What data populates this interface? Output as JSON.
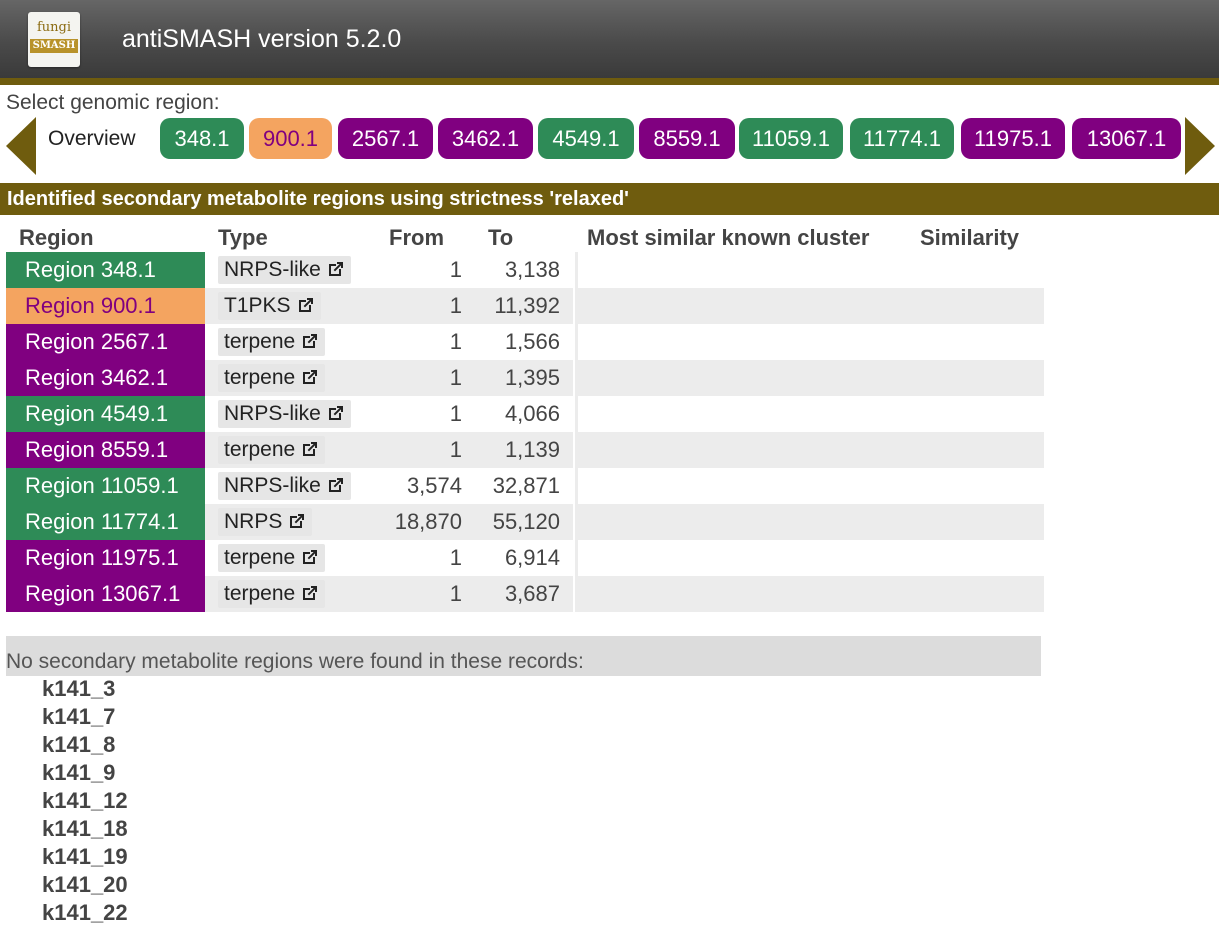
{
  "app": {
    "title": "antiSMASH version 5.2.0",
    "logo_top": "fungi",
    "logo_bottom": "SMASH"
  },
  "nav": {
    "label": "Select genomic region:",
    "overview": "Overview",
    "pills": [
      {
        "label": "348.1",
        "color": "#2e8b57"
      },
      {
        "label": "900.1",
        "color": "#f4a460"
      },
      {
        "label": "2567.1",
        "color": "#800080"
      },
      {
        "label": "3462.1",
        "color": "#800080"
      },
      {
        "label": "4549.1",
        "color": "#2e8b57"
      },
      {
        "label": "8559.1",
        "color": "#800080"
      },
      {
        "label": "11059.1",
        "color": "#2e8b57"
      },
      {
        "label": "11774.1",
        "color": "#2e8b57"
      },
      {
        "label": "11975.1",
        "color": "#800080"
      },
      {
        "label": "13067.1",
        "color": "#800080"
      }
    ]
  },
  "section_title": "Identified secondary metabolite regions using strictness 'relaxed'",
  "table": {
    "headers": {
      "region": "Region",
      "type": "Type",
      "from": "From",
      "to": "To",
      "cluster": "Most similar known cluster",
      "similarity": "Similarity"
    },
    "rows": [
      {
        "region": "Region 348.1",
        "type": "NRPS-like",
        "from": "1",
        "to": "3,138",
        "color": "#2e8b57",
        "text_color": "#ffffff"
      },
      {
        "region": "Region 900.1",
        "type": "T1PKS",
        "from": "1",
        "to": "11,392",
        "color": "#f4a460",
        "text_color": "#800080"
      },
      {
        "region": "Region 2567.1",
        "type": "terpene",
        "from": "1",
        "to": "1,566",
        "color": "#800080",
        "text_color": "#ffffff"
      },
      {
        "region": "Region 3462.1",
        "type": "terpene",
        "from": "1",
        "to": "1,395",
        "color": "#800080",
        "text_color": "#ffffff"
      },
      {
        "region": "Region 4549.1",
        "type": "NRPS-like",
        "from": "1",
        "to": "4,066",
        "color": "#2e8b57",
        "text_color": "#ffffff"
      },
      {
        "region": "Region 8559.1",
        "type": "terpene",
        "from": "1",
        "to": "1,139",
        "color": "#800080",
        "text_color": "#ffffff"
      },
      {
        "region": "Region 11059.1",
        "type": "NRPS-like",
        "from": "3,574",
        "to": "32,871",
        "color": "#2e8b57",
        "text_color": "#ffffff"
      },
      {
        "region": "Region 11774.1",
        "type": "NRPS",
        "from": "18,870",
        "to": "55,120",
        "color": "#2e8b57",
        "text_color": "#ffffff"
      },
      {
        "region": "Region 11975.1",
        "type": "terpene",
        "from": "1",
        "to": "6,914",
        "color": "#800080",
        "text_color": "#ffffff"
      },
      {
        "region": "Region 13067.1",
        "type": "terpene",
        "from": "1",
        "to": "3,687",
        "color": "#800080",
        "text_color": "#ffffff"
      }
    ]
  },
  "no_regions": {
    "text": "No secondary metabolite regions were found in these records:",
    "records": [
      "k141_3",
      "k141_7",
      "k141_8",
      "k141_9",
      "k141_12",
      "k141_18",
      "k141_19",
      "k141_20",
      "k141_22"
    ]
  }
}
